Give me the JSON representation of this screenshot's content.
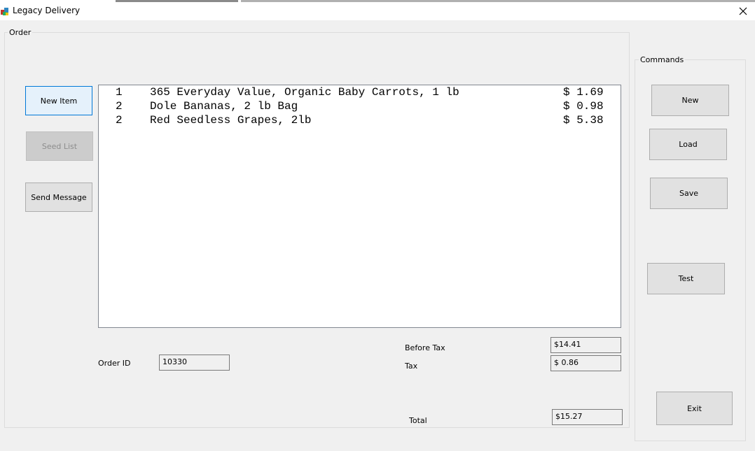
{
  "window": {
    "title": "Legacy Delivery",
    "app_icon": "app-icon",
    "close_icon": "close-icon"
  },
  "order_group": {
    "caption": "Order"
  },
  "commands_group": {
    "caption": "Commands"
  },
  "left_buttons": {
    "new_item": "New Item",
    "seed_list": "Seed List",
    "send_message": "Send Message"
  },
  "command_buttons": {
    "new": "New",
    "load": "Load",
    "save": "Save",
    "test": "Test",
    "exit": "Exit"
  },
  "items": [
    {
      "qty": "1",
      "name": "365 Everyday Value, Organic Baby Carrots, 1 lb",
      "price": "$ 1.69"
    },
    {
      "qty": "2",
      "name": "Dole Bananas, 2 lb Bag",
      "price": "$ 0.98"
    },
    {
      "qty": "2",
      "name": "Red Seedless Grapes, 2lb",
      "price": "$ 5.38"
    }
  ],
  "order_id": {
    "label": "Order ID",
    "value": "10330"
  },
  "totals": {
    "before_tax_label": "Before Tax",
    "before_tax_value": "$14.41",
    "tax_label": "Tax",
    "tax_value": "$ 0.86",
    "total_label": "Total",
    "total_value": "$15.27"
  }
}
